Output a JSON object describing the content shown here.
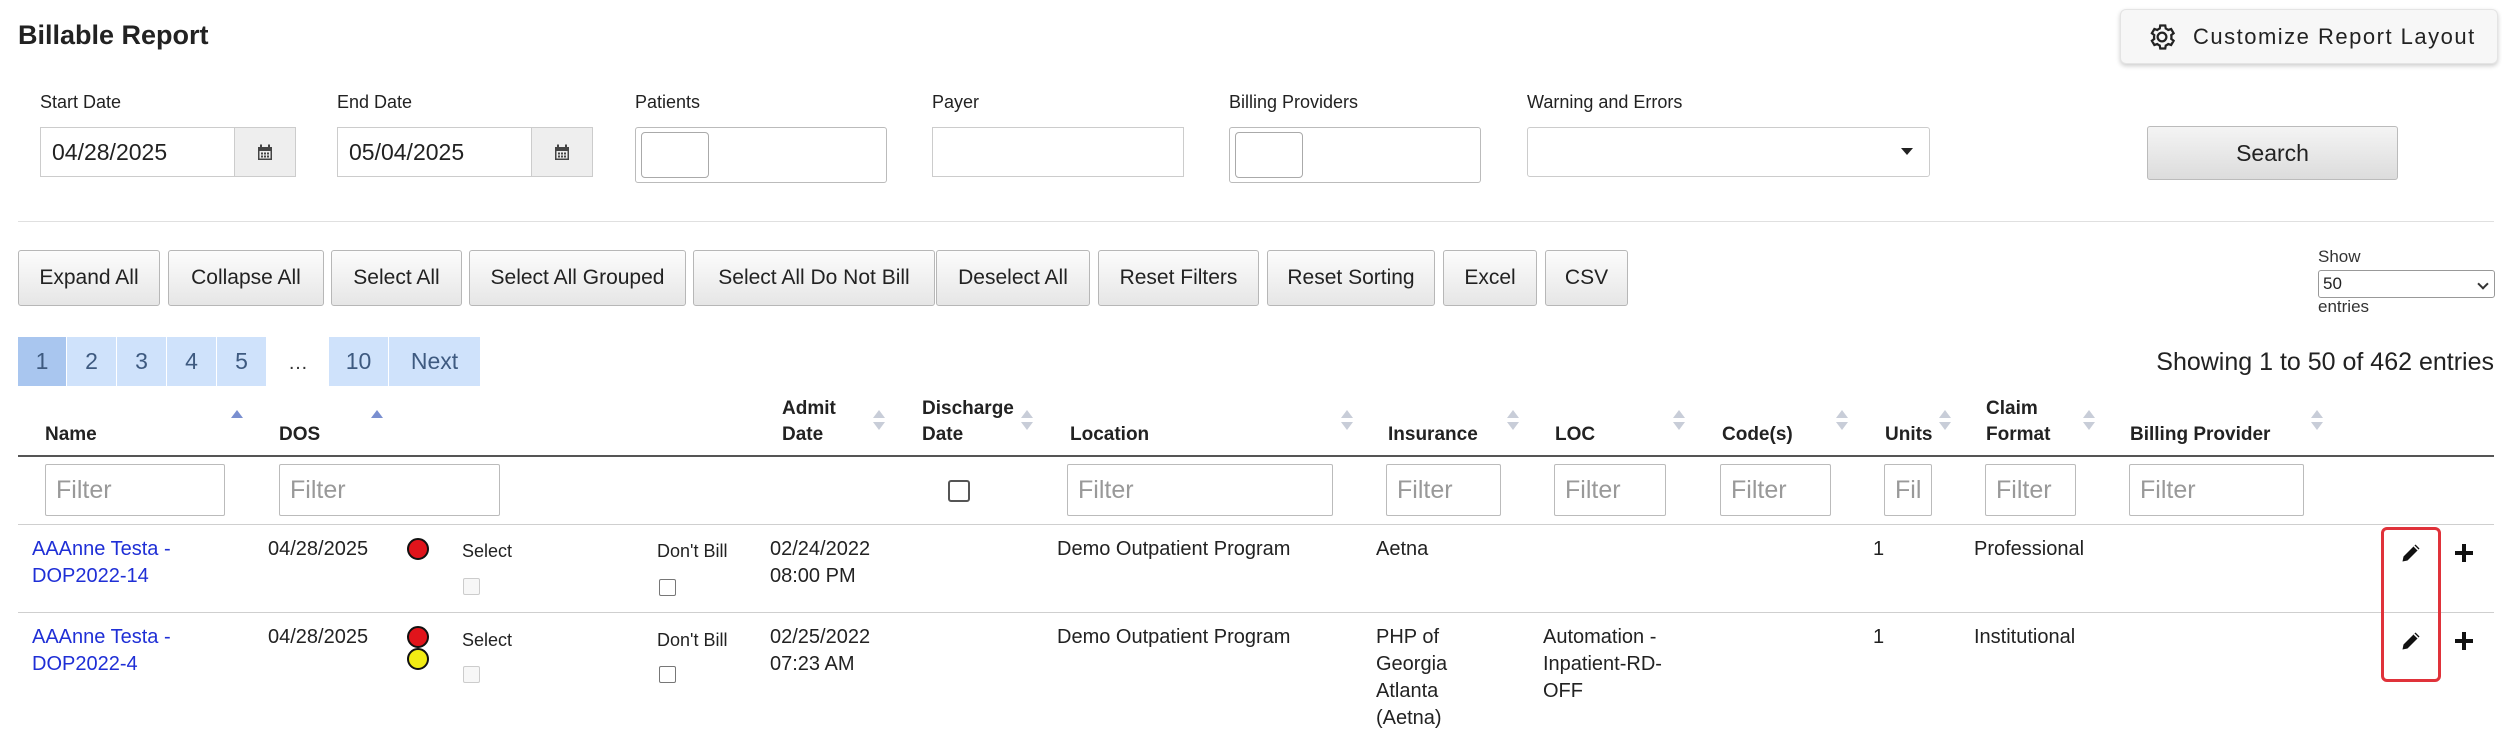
{
  "header": {
    "title": "Billable Report",
    "customize_label": "Customize Report Layout",
    "customize_icon": "gear-icon"
  },
  "filters": {
    "start_date_label": "Start Date",
    "start_date_value": "04/28/2025",
    "end_date_label": "End Date",
    "end_date_value": "05/04/2025",
    "patients_label": "Patients",
    "payer_label": "Payer",
    "billing_providers_label": "Billing Providers",
    "warnings_label": "Warning and Errors",
    "search_label": "Search",
    "calendar_icon": "calendar-icon"
  },
  "toolbar": {
    "expand_all": "Expand All",
    "collapse_all": "Collapse All",
    "select_all": "Select All",
    "select_all_grouped": "Select All Grouped",
    "select_all_do_not_bill": "Select All Do Not Bill",
    "deselect_all": "Deselect All",
    "reset_filters": "Reset Filters",
    "reset_sorting": "Reset Sorting",
    "excel": "Excel",
    "csv": "CSV"
  },
  "length_menu": {
    "show_label": "Show",
    "selected": "50",
    "entries_label": "entries"
  },
  "pagination": {
    "pages": [
      "1",
      "2",
      "3",
      "4",
      "5"
    ],
    "ellipsis": "…",
    "last": "10",
    "next": "Next",
    "active": "1",
    "showing_text": "Showing 1 to 50 of 462 entries"
  },
  "table": {
    "columns": {
      "name": "Name",
      "dos": "DOS",
      "admit_date_1": "Admit",
      "admit_date_2": "Date",
      "discharge_date_1": "Discharge",
      "discharge_date_2": "Date",
      "location": "Location",
      "insurance": "Insurance",
      "loc": "LOC",
      "codes": "Code(s)",
      "units": "Units",
      "claim_format_1": "Claim",
      "claim_format_2": "Format",
      "billing_provider": "Billing Provider"
    },
    "filter_placeholder": "Filter",
    "filter_placeholder_short": "Fil",
    "status_colors": {
      "red": "#e0141b",
      "yellow": "#f2ec14"
    },
    "rows": [
      {
        "name_line1": "AAAnne Testa -",
        "name_line2": "DOP2022-14",
        "dos": "04/28/2025",
        "status_dots": [
          "red"
        ],
        "select_label": "Select",
        "dont_bill_label": "Don't Bill",
        "admit_line1": "02/24/2022",
        "admit_line2": "08:00 PM",
        "location": "Demo Outpatient Program",
        "insurance_lines": [
          "Aetna"
        ],
        "loc_lines": [],
        "units": "1",
        "claim_format": "Professional"
      },
      {
        "name_line1": "AAAnne Testa -",
        "name_line2": "DOP2022-4",
        "dos": "04/28/2025",
        "status_dots": [
          "red",
          "yellow"
        ],
        "select_label": "Select",
        "dont_bill_label": "Don't Bill",
        "admit_line1": "02/25/2022",
        "admit_line2": "07:23 AM",
        "location": "Demo Outpatient Program",
        "insurance_lines": [
          "PHP of",
          "Georgia",
          "Atlanta",
          "(Aetna)"
        ],
        "loc_lines": [
          "Automation -",
          "Inpatient-RD-",
          "OFF"
        ],
        "units": "1",
        "claim_format": "Institutional"
      }
    ]
  }
}
